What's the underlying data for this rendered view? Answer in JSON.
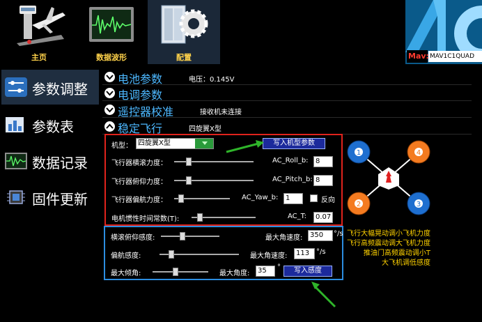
{
  "toolbar": {
    "home_label": "主页",
    "wave_label": "数据波形",
    "config_label": "配置",
    "mav_label": "Mav:",
    "mav_value": "MAV1C1QUAD"
  },
  "sidebar": {
    "items": [
      {
        "label": "参数调整",
        "icon": "sliders-icon"
      },
      {
        "label": "参数表",
        "icon": "bar-chart-icon"
      },
      {
        "label": "数据记录",
        "icon": "waveform-icon"
      },
      {
        "label": "固件更新",
        "icon": "chip-icon"
      }
    ]
  },
  "sections": {
    "battery": {
      "title": "电池参数",
      "sub": "电压：0.145V"
    },
    "esc": {
      "title": "电调参数"
    },
    "rc": {
      "title": "遥控器校准",
      "sub": "接收机未连接"
    },
    "stable": {
      "title": "稳定飞行",
      "sub": "四旋翼X型"
    }
  },
  "frame": {
    "label": "机型：",
    "selected": "四旋翼X型",
    "write_button": "写入机型参数"
  },
  "gains": {
    "roll_label": "飞行器横滚力度：",
    "roll_name": "AC_Roll_b:",
    "roll_value": "8",
    "roll_level": 0.16,
    "pitch_label": "飞行器俯仰力度：",
    "pitch_name": "AC_Pitch_b:",
    "pitch_value": "8",
    "pitch_level": 0.16,
    "yaw_label": "飞行器偏航力度：",
    "yaw_name": "AC_Yaw_b:",
    "yaw_value": "1",
    "yaw_level": 0.08,
    "reverse_label": "反向",
    "inertia_label": "电机惯性时间常数(T):",
    "inertia_name": "AC_T:",
    "inertia_value": "0.07",
    "inertia_level": 0.1
  },
  "sensitivity": {
    "rp_label": "横滚俯仰感度:",
    "rp_rate_label": "最大角速度:",
    "rp_rate_value": "350",
    "rp_level": 0.35,
    "yaw_label": "偏航感度:",
    "yaw_rate_label": "最大角速度:",
    "yaw_rate_value": "113",
    "yaw_level": 0.12,
    "tilt_label": "最大倾角:",
    "tilt_angle_label": "最大角度:",
    "tilt_angle_value": "35",
    "tilt_level": 0.4,
    "unit_rate": "°/s",
    "unit_deg": "°",
    "write_button": "写入感度"
  },
  "notes": [
    "飞行大幅晃动调小飞机力度",
    "飞行高频震动调大飞机力度",
    "推油门高频震动调小T",
    "大飞机调低感度"
  ],
  "motors": [
    "1",
    "2",
    "3",
    "4"
  ],
  "colors": {
    "accent_blue": "#4db8ff",
    "red_box": "#e0231c",
    "blue_box": "#2c8de0",
    "note_yellow": "#ffd200",
    "arrow_green": "#2fb52a",
    "motor_orange": "#f47b20",
    "motor_blue": "#1e6fd0"
  }
}
